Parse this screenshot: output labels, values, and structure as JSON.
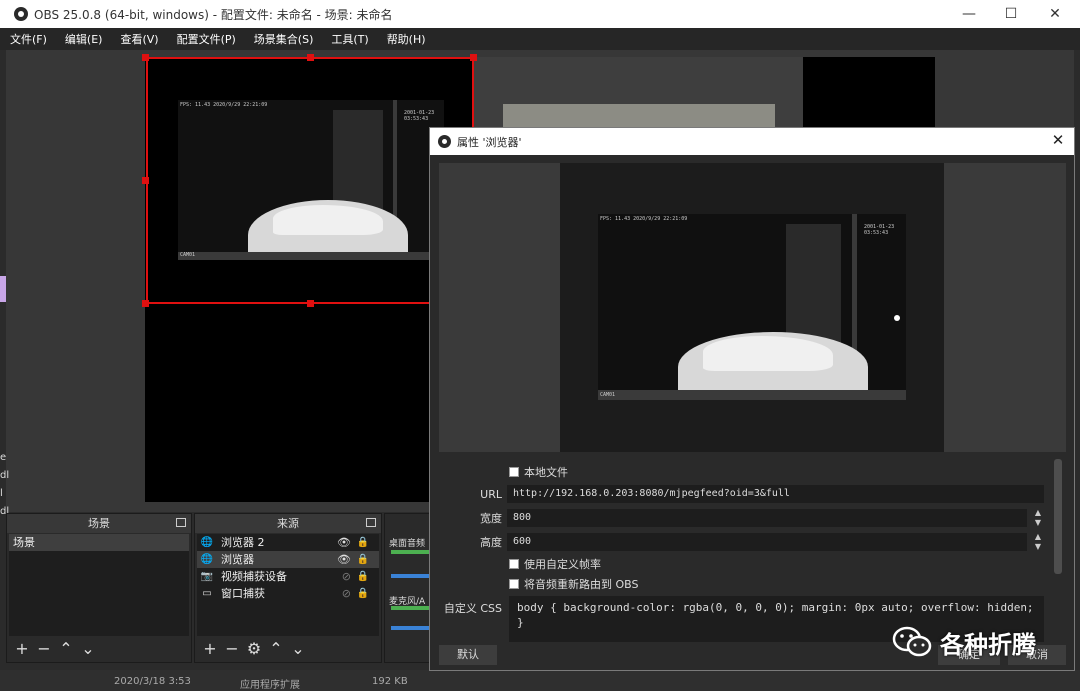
{
  "window": {
    "title": "OBS 25.0.8 (64-bit, windows) - 配置文件: 未命名 - 场景: 未命名"
  },
  "menubar": [
    "文件(F)",
    "编辑(E)",
    "查看(V)",
    "配置文件(P)",
    "场景集合(S)",
    "工具(T)",
    "帮助(H)"
  ],
  "preview": {
    "cam_fps_text": "FPS: 11.43 2020/9/29 22:21:09",
    "cam_time_text": "2001-01-23 03:53:43",
    "cam_name_text": "CAM01"
  },
  "docks": {
    "scenes": {
      "title": "场景",
      "items": [
        "场景"
      ]
    },
    "sources": {
      "title": "来源",
      "items": [
        {
          "label": "浏览器 2",
          "icon": "globe-icon",
          "visible": true
        },
        {
          "label": "浏览器",
          "icon": "globe-icon",
          "visible": true
        },
        {
          "label": "视频捕获设备",
          "icon": "camera-icon",
          "visible": false
        },
        {
          "label": "窗口捕获",
          "icon": "window-icon",
          "visible": false
        }
      ]
    },
    "mixer": {
      "ch1": "桌面音频",
      "ch2": "麦克风/A"
    }
  },
  "left_edge_text": [
    "e",
    "dl",
    "l",
    "dl"
  ],
  "statusbar": {
    "left_date": "2020/3/18 3:53",
    "left_type": "应用程序扩展",
    "left_size": "192 KB"
  },
  "dialog": {
    "title": "属性 '浏览器'",
    "local_file_label": "本地文件",
    "url_label": "URL",
    "url_value": "http://192.168.0.203:8080/mjpegfeed?oid=3&full",
    "width_label": "宽度",
    "width_value": "800",
    "height_label": "高度",
    "height_value": "600",
    "custom_fps_label": "使用自定义帧率",
    "reroute_audio_label": "将音频重新路由到 OBS",
    "css_label": "自定义 CSS",
    "css_value": "body { background-color: rgba(0, 0, 0, 0); margin: 0px auto; overflow: hidden; }",
    "defaults_button": "默认",
    "ok_button": "确定",
    "cancel_button": "取消"
  },
  "watermark": {
    "text": "各种折腾"
  },
  "colors": {
    "selection": "#e01010",
    "meter_green": "#4caf50",
    "meter_blue": "#3a82d6"
  }
}
